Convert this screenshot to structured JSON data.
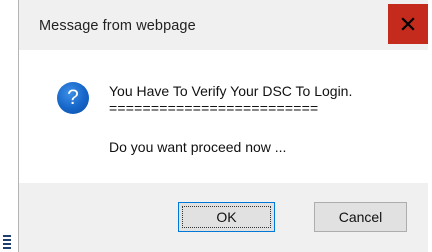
{
  "dialog": {
    "title": "Message from webpage",
    "close_icon": "close-icon",
    "question_icon": "question-icon",
    "message": "You Have To Verify Your DSC To Login.",
    "separator": "=========================",
    "question": "Do you want proceed now ...",
    "ok_label": "OK",
    "cancel_label": "Cancel"
  },
  "colors": {
    "close_button": "#c42b1c",
    "dialog_background": "#f0f0f0",
    "content_background": "#ffffff",
    "icon_blue": "#1565c8",
    "ok_border": "#0078d7"
  }
}
